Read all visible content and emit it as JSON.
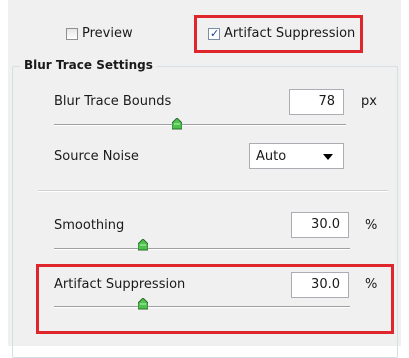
{
  "options": {
    "preview": {
      "label": "Preview",
      "checked": false
    },
    "artifact_suppression": {
      "label": "Artifact Suppression",
      "checked": true
    }
  },
  "group": {
    "title": "Blur Trace Settings",
    "blur_trace_bounds": {
      "label": "Blur Trace Bounds",
      "value": "78",
      "unit": "px",
      "slider_fraction": 0.42
    },
    "source_noise": {
      "label": "Source Noise",
      "selected": "Auto"
    },
    "smoothing": {
      "label": "Smoothing",
      "value": "30.0",
      "unit": "%",
      "slider_fraction": 0.3
    },
    "artifact_suppression": {
      "label": "Artifact Suppression",
      "value": "30.0",
      "unit": "%",
      "slider_fraction": 0.3
    }
  },
  "colors": {
    "highlight": "#e0262d",
    "panel": "#f0f0f0",
    "slider_thumb": "#4cc24c"
  }
}
